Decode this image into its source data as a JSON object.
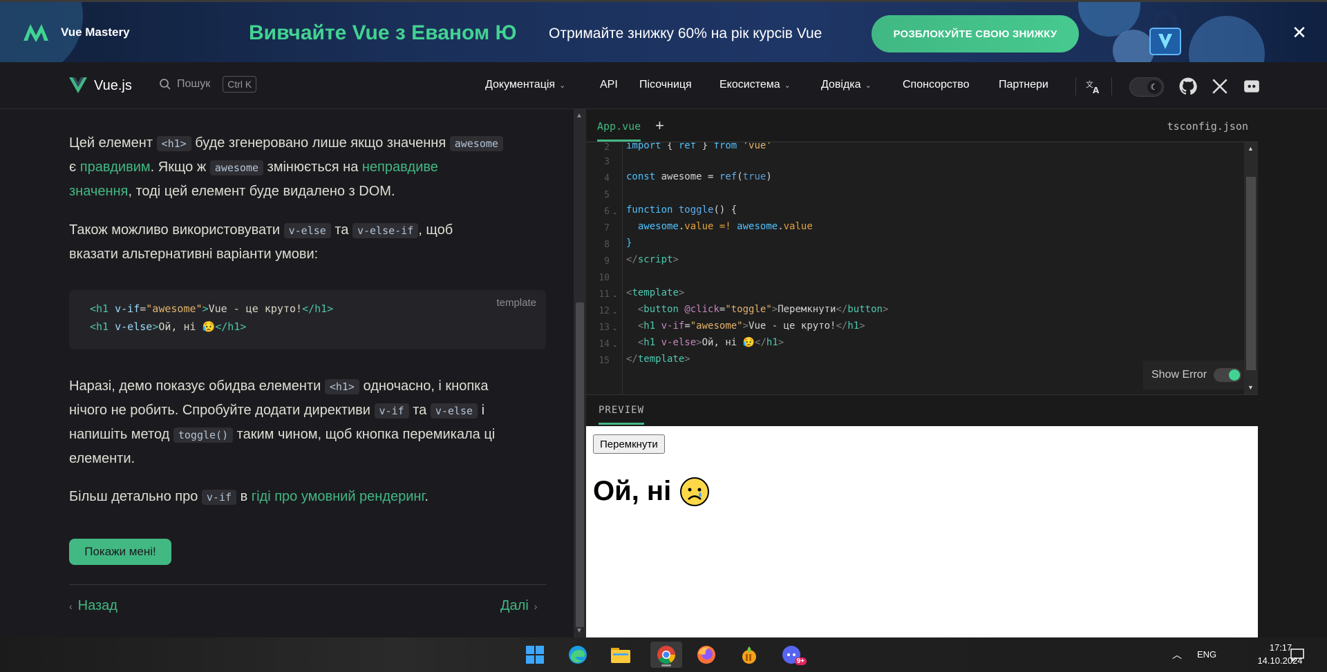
{
  "banner": {
    "brand": "Vue Mastery",
    "headline": "Вивчайте Vue з Еваном Ю",
    "offer": "Отримайте знижку 60% на рік курсів Vue",
    "cta": "РОЗБЛОКУЙТЕ СВОЮ ЗНИЖКУ",
    "close": "✕",
    "colors": {
      "accent": "#42d392",
      "bg": "#1a2f58"
    }
  },
  "nav": {
    "logo": "Vue.js",
    "search_label": "Пошук",
    "search_kbd": "Ctrl K",
    "items": [
      {
        "label": "Документація",
        "dropdown": true
      },
      {
        "label": "API",
        "dropdown": false
      },
      {
        "label": "Пісочниця",
        "dropdown": false
      },
      {
        "label": "Екосистема",
        "dropdown": true
      },
      {
        "label": "Довідка",
        "dropdown": true
      },
      {
        "label": "Спонсорство",
        "dropdown": false
      },
      {
        "label": "Партнери",
        "dropdown": false
      }
    ],
    "icons": [
      "translate-icon",
      "moon-icon",
      "github-icon",
      "x-twitter-icon",
      "discord-icon"
    ]
  },
  "content": {
    "p1": {
      "t1": "Цей елемент ",
      "c1": "<h1>",
      "t2": " буде згенеровано лише якщо значення ",
      "c2": "awesome",
      "t3": "є ",
      "l1": "правдивим",
      "t4": ". Якщо ж ",
      "c3": "awesome",
      "t5": " змінюється на ",
      "l2a": "неправдиве",
      "l2b": "значення",
      "t6": ", тоді цей елемент буде видалено з DOM."
    },
    "p2": {
      "t1": "Також можливо використовувати ",
      "c1": "v-else",
      "t2": " та ",
      "c2": "v-else-if",
      "t3": ", щоб",
      "t4": "вказати альтернативні варіанти умови:"
    },
    "code_block": {
      "lang": "template",
      "lines": [
        {
          "open": "<h1",
          "attr": " v-if",
          "eq": "=",
          "val": "\"awesome\"",
          "close": ">",
          "text": "Vue - це круто!",
          "end": "</h1>"
        },
        {
          "open": "<h1",
          "attr": " v-else",
          "eq": "",
          "val": "",
          "close": ">",
          "text": "Ой, ні 😥",
          "end": "</h1>"
        }
      ]
    },
    "p3": {
      "t1": "Наразі, демо показує обидва елементи ",
      "c1": "<h1>",
      "t2": " одночасно, і кнопка",
      "t3": "нічого не робить. Спробуйте додати директиви ",
      "c2": "v-if",
      "t4": " та ",
      "c3": "v-else",
      "t5": " і",
      "t6": "напишіть метод ",
      "c4": "toggle()",
      "t7": " таким чином, щоб кнопка перемикала ці",
      "t8": "елементи."
    },
    "p4": {
      "t1": "Більш детально про ",
      "c1": "v-if",
      "t2": " в ",
      "l1": "гіді про умовний рендеринг",
      "t3": "."
    },
    "show_me": "Покажи мені!",
    "prev": "Назад",
    "next": "Далі"
  },
  "repl": {
    "tab_active": "App.vue",
    "tab_add": "+",
    "tab_right": "tsconfig.json",
    "line_numbers": [
      "2",
      "3",
      "4",
      "5",
      "6",
      "7",
      "8",
      "9",
      "10",
      "11",
      "12",
      "13",
      "14",
      "15"
    ],
    "code": {
      "l2": [
        "import",
        " { ",
        "ref",
        " } ",
        "from",
        " ",
        "'vue'"
      ],
      "l4": [
        "const",
        " awesome ",
        "=",
        " ",
        "ref",
        "(",
        "true",
        ")"
      ],
      "l6": [
        "function",
        " ",
        "toggle",
        "() {"
      ],
      "l7": [
        "  awesome",
        ".",
        "value",
        " =! ",
        "awesome",
        ".",
        "value"
      ],
      "l8": "}",
      "l9": [
        "</",
        "script",
        ">"
      ],
      "l11": [
        "<",
        "template",
        ">"
      ],
      "l12": [
        "  <",
        "button",
        " ",
        "@click",
        "=",
        "\"toggle\"",
        ">",
        "Перемкнути",
        "</",
        "button",
        ">"
      ],
      "l13": [
        "  <",
        "h1",
        " ",
        "v-if",
        "=",
        "\"awesome\"",
        ">",
        "Vue - це круто!",
        "</",
        "h1",
        ">"
      ],
      "l14": [
        "  <",
        "h1",
        " ",
        "v-else",
        ">",
        "Ой, ні 😥",
        "</",
        "h1",
        ">"
      ],
      "l15": [
        "</",
        "template",
        ">"
      ]
    },
    "show_error_label": "Show Error",
    "show_error_on": true,
    "preview_tab": "PREVIEW",
    "preview_button": "Перемкнути",
    "preview_heading": "Ой, ні"
  },
  "taskbar": {
    "apps": [
      "windows-start-icon",
      "edge-icon",
      "file-explorer-icon",
      "chrome-icon",
      "firefox-icon",
      "fl-studio-icon",
      "discord-app-icon"
    ],
    "discord_badge": "9+",
    "lang": "ENG",
    "time": "17:17",
    "date": "14.10.2024"
  }
}
